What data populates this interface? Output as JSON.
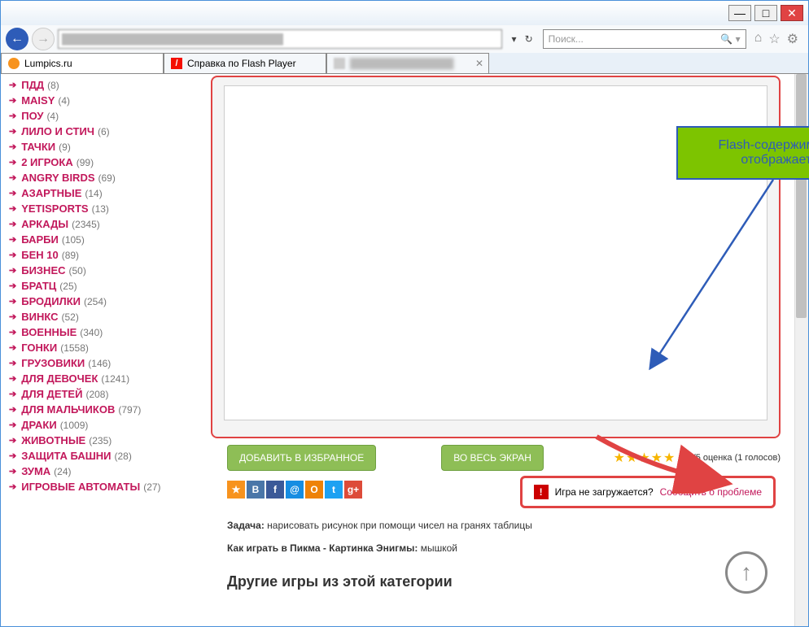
{
  "window": {
    "minimize": "—",
    "maximize": "□",
    "close": "✕"
  },
  "nav": {
    "back": "←",
    "fwd": "→",
    "refresh": "↻",
    "stop": "✕",
    "dropdown": "▾"
  },
  "search": {
    "placeholder": "Поиск...",
    "icon": "🔍",
    "dropdown": "▾"
  },
  "nav_icons": {
    "home": "⌂",
    "star": "☆",
    "gear": "⚙"
  },
  "tabs": [
    {
      "label": "Lumpics.ru",
      "icon": "orange"
    },
    {
      "label": "Справка по Flash Player",
      "icon": "adobe",
      "icon_text": "/"
    },
    {
      "label": "",
      "icon": "blur",
      "closable": true
    }
  ],
  "sidebar": [
    {
      "name": "ПДД",
      "count": 8
    },
    {
      "name": "MAISY",
      "count": 4
    },
    {
      "name": "ПОУ",
      "count": 4
    },
    {
      "name": "ЛИЛО И СТИЧ",
      "count": 6
    },
    {
      "name": "ТАЧКИ",
      "count": 9
    },
    {
      "name": "2 ИГРОКА",
      "count": 99
    },
    {
      "name": "ANGRY BIRDS",
      "count": 69
    },
    {
      "name": "АЗАРТНЫЕ",
      "count": 14
    },
    {
      "name": "YETISPORTS",
      "count": 13
    },
    {
      "name": "АРКАДЫ",
      "count": 2345
    },
    {
      "name": "БАРБИ",
      "count": 105
    },
    {
      "name": "БЕН 10",
      "count": 89
    },
    {
      "name": "БИЗНЕС",
      "count": 50
    },
    {
      "name": "БРАТЦ",
      "count": 25
    },
    {
      "name": "БРОДИЛКИ",
      "count": 254
    },
    {
      "name": "ВИНКС",
      "count": 52
    },
    {
      "name": "ВОЕННЫЕ",
      "count": 340
    },
    {
      "name": "ГОНКИ",
      "count": 1558
    },
    {
      "name": "ГРУЗОВИКИ",
      "count": 146
    },
    {
      "name": "ДЛЯ ДЕВОЧЕК",
      "count": 1241
    },
    {
      "name": "ДЛЯ ДЕТЕЙ",
      "count": 208
    },
    {
      "name": "ДЛЯ МАЛЬЧИКОВ",
      "count": 797
    },
    {
      "name": "ДРАКИ",
      "count": 1009
    },
    {
      "name": "ЖИВОТНЫЕ",
      "count": 235
    },
    {
      "name": "ЗАЩИТА БАШНИ",
      "count": 28
    },
    {
      "name": "ЗУМА",
      "count": 24
    },
    {
      "name": "ИГРОВЫЕ АВТОМАТЫ",
      "count": 27
    }
  ],
  "callout": {
    "text": "Flash-содержимое не отображается"
  },
  "buttons": {
    "favorite": "ДОБАВИТЬ В ИЗБРАННОЕ",
    "fullscreen": "ВО ВЕСЬ ЭКРАН"
  },
  "rating": {
    "stars": "★★★★★",
    "text": "5.0/5 оценка (1 голосов)"
  },
  "social": {
    "fav": "★",
    "vk": "B",
    "fb": "f",
    "mail": "@",
    "ok": "O",
    "tw": "t",
    "gp": "g+"
  },
  "report": {
    "warn": "!",
    "question": "Игра не загружается?",
    "link": "Сообщить о проблеме"
  },
  "task": {
    "label": "Задача:",
    "text": "нарисовать рисунок при помощи чисел на гранях таблицы"
  },
  "howto": {
    "label": "Как играть в Пикма - Картинка Энигмы:",
    "text": "мышкой"
  },
  "other_games": "Другие игры из этой категории",
  "scroll_top": "↑"
}
